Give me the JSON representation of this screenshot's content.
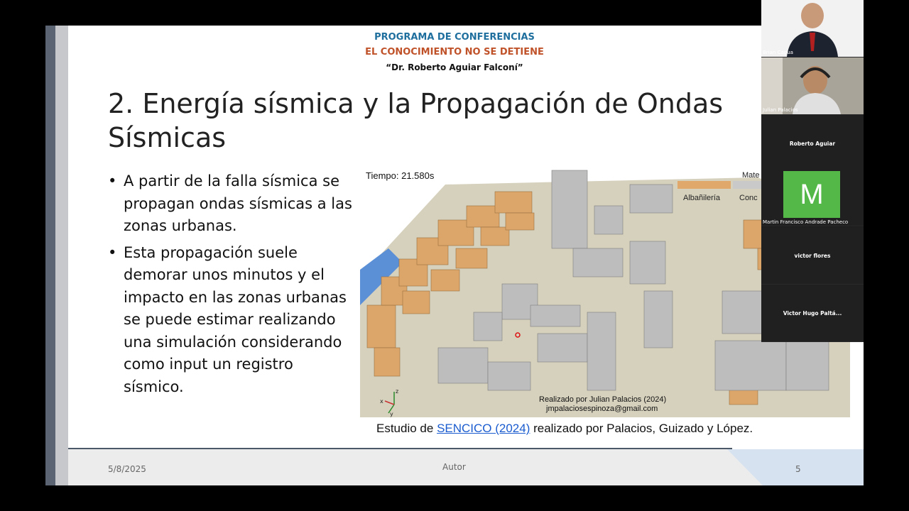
{
  "slide": {
    "header": {
      "line1": "PROGRAMA DE CONFERENCIAS",
      "line2": "EL CONOCIMIENTO NO SE DETIENE",
      "line3": "“Dr. Roberto Aguiar Falconí”"
    },
    "title": "2. Energía sísmica y la Propagación de Ondas Sísmicas",
    "bullets": [
      "A partir de la falla sísmica se propagan ondas sísmicas a las zonas urbanas.",
      "Esta propagación suele demorar unos minutos y el impacto en las zonas urbanas se puede estimar realizando una simulación considerando como input un registro sísmico."
    ],
    "simulation": {
      "time_label": "Tiempo: 21.580s",
      "legend_title": "Mate",
      "legend_items": [
        "Albañilería",
        "Conc"
      ],
      "credit_line1": "Realizado por Julian Palacios (2024)",
      "credit_line2": "jmpalaciosespinoza@gmail.com",
      "axis_labels": [
        "z",
        "y",
        "x"
      ]
    },
    "caption": {
      "prefix": "Estudio de ",
      "link": "SENCICO (2024)",
      "suffix": " realizado por Palacios, Guizado y López."
    },
    "footer": {
      "date": "5/8/2025",
      "author": "Autor",
      "page": "5"
    }
  },
  "participants": [
    {
      "name": "Brian Cagua",
      "type": "video"
    },
    {
      "name": "Julian Palacios",
      "type": "video"
    },
    {
      "name": "Roberto Aguiar",
      "type": "name"
    },
    {
      "name": "Martin Francisco Andrade Pacheco",
      "type": "avatar",
      "initial": "M"
    },
    {
      "name": "victor flores",
      "type": "name"
    },
    {
      "name": "Victor Hugo Paltá...",
      "type": "name"
    }
  ],
  "colors": {
    "header_blue": "#1f6f9e",
    "header_orange": "#c0522a",
    "link": "#1a5ccf",
    "avatar_green": "#54b848",
    "masonry": "#e0a86a",
    "concrete": "#b8b8b8"
  }
}
